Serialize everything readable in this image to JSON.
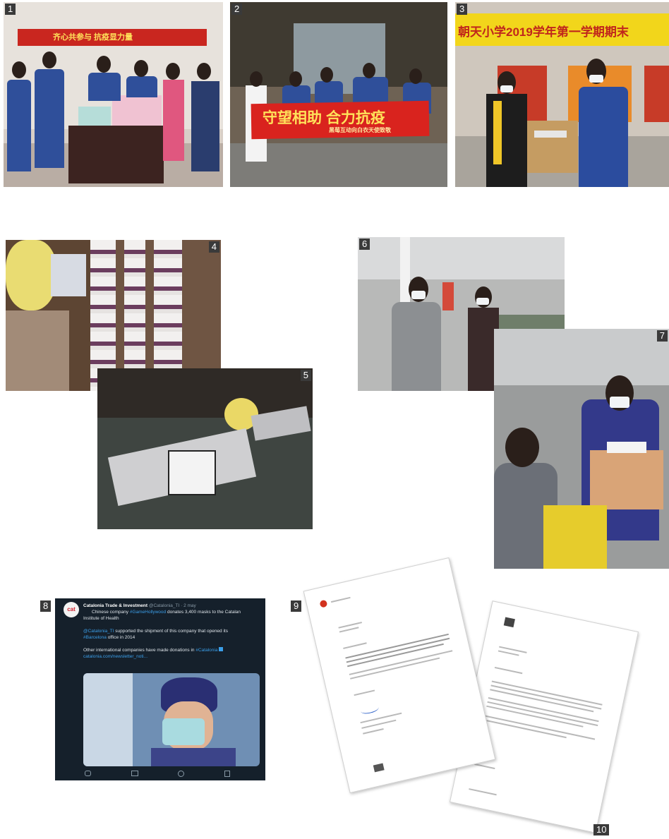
{
  "photos": [
    {
      "number": "1"
    },
    {
      "number": "2",
      "banner_text": "守望相助 合力抗疫",
      "banner_sub": "黑莓互动向白衣天使致敬"
    },
    {
      "number": "3",
      "banner_text": "朝天小学2019学年第一学期期末"
    },
    {
      "number": "4"
    },
    {
      "number": "5"
    },
    {
      "number": "6"
    },
    {
      "number": "7"
    },
    {
      "number": "8"
    },
    {
      "number": "9"
    },
    {
      "number": "10"
    }
  ],
  "photo1": {
    "banner_text": "齐心共参与  抗疫显力量"
  },
  "tweet": {
    "author": "Catalonia Trade & Investment",
    "handle": "@Catalonia_TI · 2 may",
    "avatar_text": "cat",
    "line1_a": "Chinese company ",
    "line1_link": "#GameHollywood",
    "line1_b": " donates 3,400 masks to the Catalan",
    "line2": "Institute of Health",
    "line3_link": "@Catalonia_TI",
    "line3_b": " supported the shipment of this company that opened its",
    "line4_link": "#Barcelona",
    "line4_b": " office in 2014",
    "line5_a": "Other international companies have made donations in ",
    "line5_link": "#Catalonia",
    "line6_link": "catalonia.com/newsletter_noti..."
  }
}
